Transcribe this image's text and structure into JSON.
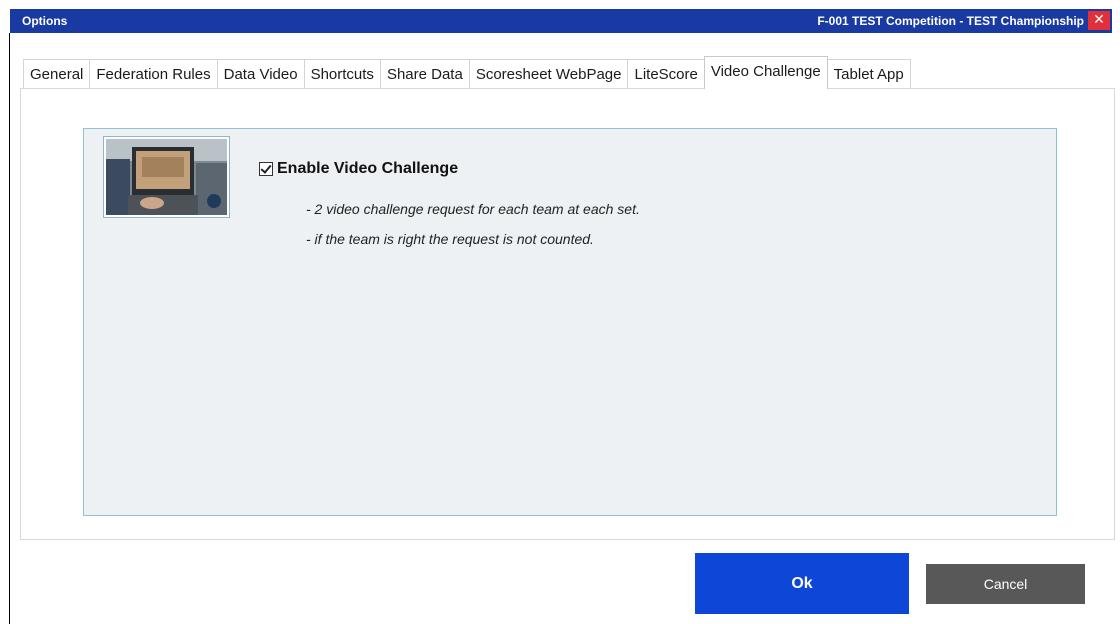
{
  "window": {
    "title": "Options",
    "context": "F-001  TEST Competition - TEST Championship",
    "close_icon": "close-icon",
    "colors": {
      "titlebar": "#1a3aa3",
      "close": "#e0303a",
      "ok_button": "#0e47d8",
      "cancel_button": "#585858",
      "panel_background": "#eef1f3",
      "panel_border": "#8fc3d6"
    }
  },
  "tabs": [
    {
      "label": "General",
      "active": false
    },
    {
      "label": "Federation Rules",
      "active": false
    },
    {
      "label": "Data Video",
      "active": false
    },
    {
      "label": "Shortcuts",
      "active": false
    },
    {
      "label": "Share Data",
      "active": false
    },
    {
      "label": "Scoresheet WebPage",
      "active": false
    },
    {
      "label": "LiteScore",
      "active": false
    },
    {
      "label": "Video Challenge",
      "active": true
    },
    {
      "label": "Tablet App",
      "active": false
    }
  ],
  "video_challenge": {
    "thumbnail": "video-challenge-photo",
    "enable_label": "Enable Video Challenge",
    "enabled": true,
    "notes": [
      "- 2 video challenge request for each team at each set.",
      "- if the team is right the request is not counted."
    ]
  },
  "footer": {
    "ok_label": "Ok",
    "cancel_label": "Cancel"
  }
}
